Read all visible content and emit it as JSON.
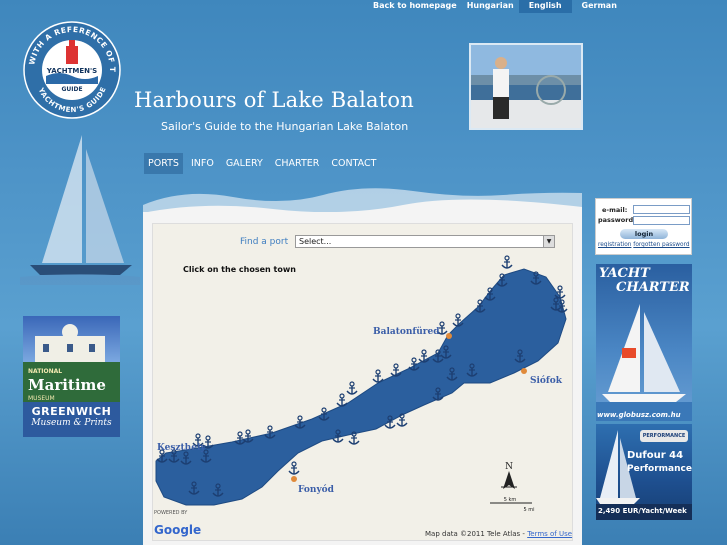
{
  "top_bar": {
    "back_link": "Back to homepage",
    "languages": [
      "Hungarian",
      "English",
      "German"
    ],
    "active_language": "English"
  },
  "logo": {
    "arc_top": "WITH A REFERENCE OF THE",
    "arc_bottom": "YACHTMEN'S GUIDE",
    "center_line1": "YACHTMEN'S",
    "center_line2": "GUIDE"
  },
  "header": {
    "title": "Harbours of Lake Balaton",
    "subtitle": "Sailor's Guide to the Hungarian Lake Balaton"
  },
  "nav": {
    "items": [
      "PORTS",
      "INFO",
      "GALERY",
      "CHARTER",
      "CONTACT"
    ],
    "active": "PORTS"
  },
  "find_port": {
    "label": "Find a port",
    "selected": "Select..."
  },
  "map": {
    "hint": "Click on the chosen town",
    "towns": [
      "Balatonfüred",
      "Siófok",
      "Keszthely",
      "Fonyód"
    ],
    "scale_km": "5 km",
    "scale_mi": "5 mi",
    "north": "N",
    "attribution": "Map data ©2011 Tele Atlas -",
    "terms_link": "Terms of Use",
    "powered_by": "POWERED BY",
    "google": "Google",
    "lake_color": "#2b5f9e",
    "port_count": 40
  },
  "login": {
    "email_label": "e-mail:",
    "password_label": "password:",
    "button": "login",
    "registration_link": "registration",
    "forgotten_link": "forgotten password"
  },
  "ads": {
    "greenwich": {
      "line1": "NATIONAL",
      "line2": "Maritime",
      "line3": "MUSEUM",
      "title": "GREENWICH",
      "subtitle": "Museum & Prints"
    },
    "yacht_charter": {
      "line1": "YACHT",
      "line2": "CHARTER",
      "url": "www.globusz.com.hu"
    },
    "dufour": {
      "brand": "PERFORMANCE",
      "name": "Dufour 44",
      "model": "Performance",
      "price": "2,490 EUR/Yacht/Week"
    }
  }
}
